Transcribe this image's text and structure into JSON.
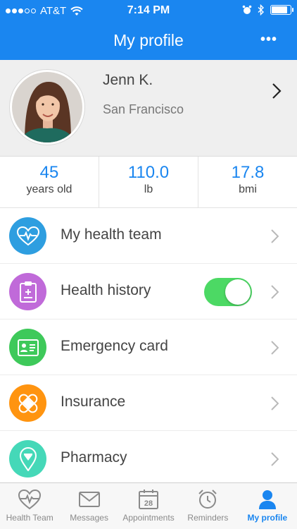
{
  "status": {
    "carrier": "AT&T",
    "time": "7:14 PM",
    "battery_level": 0.88
  },
  "nav": {
    "title": "My profile",
    "more_label": "•••"
  },
  "profile": {
    "name": "Jenn K.",
    "city": "San Francisco"
  },
  "stats": [
    {
      "value": "45",
      "unit": "years old"
    },
    {
      "value": "110.0",
      "unit": "lb"
    },
    {
      "value": "17.8",
      "unit": "bmi"
    }
  ],
  "menu": [
    {
      "label": "My health team",
      "icon": "heart-pulse-icon",
      "color": "#2e9ee0"
    },
    {
      "label": "Health history",
      "icon": "clipboard-icon",
      "color": "#c06ad9",
      "toggle_on": true
    },
    {
      "label": "Emergency card",
      "icon": "id-card-icon",
      "color": "#3ec95a"
    },
    {
      "label": "Insurance",
      "icon": "bandage-icon",
      "color": "#ff9410"
    },
    {
      "label": "Pharmacy",
      "icon": "pharmacy-pin-icon",
      "color": "#45d8b8"
    }
  ],
  "tabs": [
    {
      "label": "Health Team",
      "icon": "heart-pulse-icon",
      "active": false
    },
    {
      "label": "Messages",
      "icon": "envelope-icon",
      "active": false
    },
    {
      "label": "Appointments",
      "icon": "calendar-icon",
      "day": "28",
      "active": false
    },
    {
      "label": "Reminders",
      "icon": "alarm-clock-icon",
      "active": false
    },
    {
      "label": "My profile",
      "icon": "person-icon",
      "active": true
    }
  ],
  "colors": {
    "accent": "#1a86f0",
    "toggle_on": "#4cd964"
  }
}
